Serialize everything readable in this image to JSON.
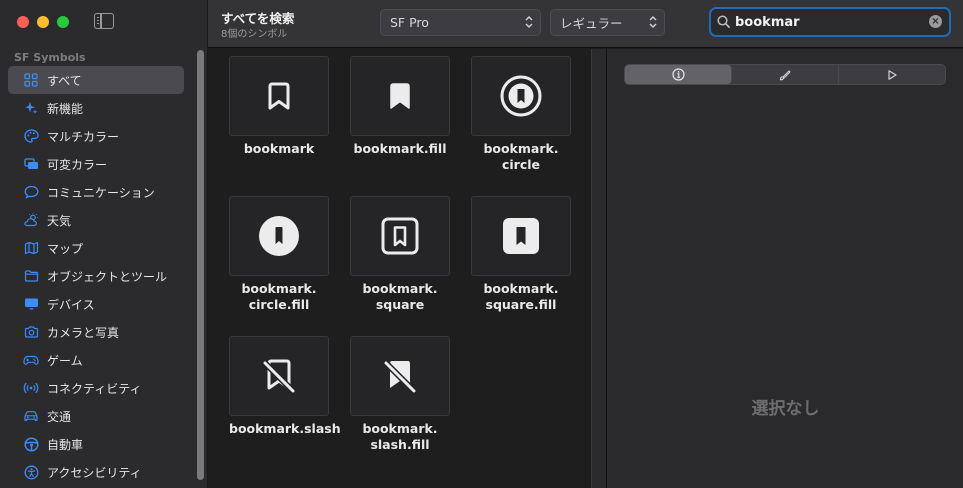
{
  "sidebar": {
    "section_title": "SF Symbols",
    "items": [
      {
        "label": "すべて",
        "icon": "grid-icon",
        "active": true
      },
      {
        "label": "新機能",
        "icon": "sparkles-icon"
      },
      {
        "label": "マルチカラー",
        "icon": "palette-icon"
      },
      {
        "label": "可変カラー",
        "icon": "variable-color-icon"
      },
      {
        "label": "コミュニケーション",
        "icon": "message-bubble-icon"
      },
      {
        "label": "天気",
        "icon": "cloud-sun-icon"
      },
      {
        "label": "マップ",
        "icon": "map-icon"
      },
      {
        "label": "オブジェクトとツール",
        "icon": "folder-icon"
      },
      {
        "label": "デバイス",
        "icon": "display-icon"
      },
      {
        "label": "カメラと写真",
        "icon": "camera-icon"
      },
      {
        "label": "ゲーム",
        "icon": "gamecontroller-icon"
      },
      {
        "label": "コネクティビティ",
        "icon": "antenna-icon"
      },
      {
        "label": "交通",
        "icon": "car-icon"
      },
      {
        "label": "自動車",
        "icon": "steering-wheel-icon"
      },
      {
        "label": "アクセシビリティ",
        "icon": "accessibility-icon"
      }
    ]
  },
  "toolbar": {
    "title": "すべてを検索",
    "subtitle": "8個のシンボル",
    "font_popup": "SF Pro",
    "weight_popup": "レギュラー"
  },
  "search": {
    "value": "bookmar"
  },
  "symbols": [
    {
      "label": "bookmark",
      "icon": "bookmark-icon"
    },
    {
      "label": "bookmark.fill",
      "icon": "bookmark-fill-icon"
    },
    {
      "label": "bookmark.\ncircle",
      "icon": "bookmark-circle-icon"
    },
    {
      "label": "bookmark.\ncircle.fill",
      "icon": "bookmark-circle-fill-icon"
    },
    {
      "label": "bookmark.\nsquare",
      "icon": "bookmark-square-icon"
    },
    {
      "label": "bookmark.\nsquare.fill",
      "icon": "bookmark-square-fill-icon"
    },
    {
      "label": "bookmark.slash",
      "icon": "bookmark-slash-icon"
    },
    {
      "label": "bookmark.\nslash.fill",
      "icon": "bookmark-slash-fill-icon"
    }
  ],
  "inspector": {
    "tabs": [
      {
        "icon": "info-icon",
        "active": true
      },
      {
        "icon": "paintbrush-icon"
      },
      {
        "icon": "play-icon"
      }
    ],
    "empty_text": "選択なし"
  },
  "colors": {
    "accent": "#3b8df7",
    "search_border": "#1f6bb5"
  }
}
